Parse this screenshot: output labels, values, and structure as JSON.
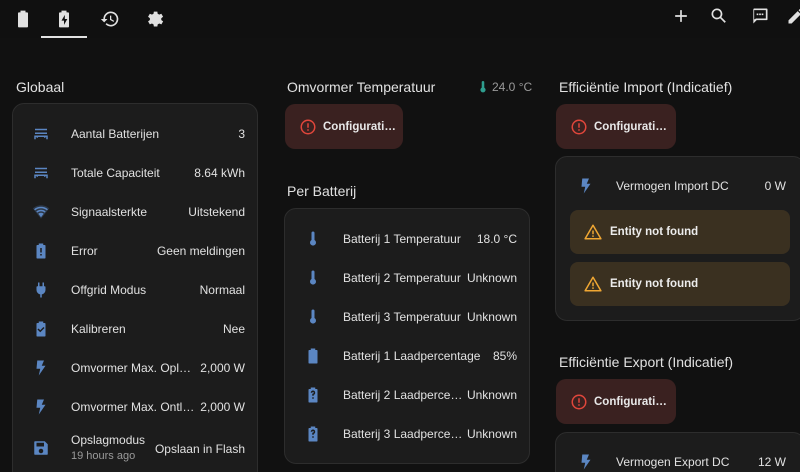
{
  "colors": {
    "accent_icon": "#5b86c2",
    "error": "#e0463b",
    "warning": "#f0a733",
    "background": "#111111",
    "card": "#1c1c1c"
  },
  "topbar": {
    "tabs": [
      {
        "icon": "battery-icon",
        "active": false
      },
      {
        "icon": "battery-charging-icon",
        "active": true
      },
      {
        "icon": "history-icon",
        "active": false
      },
      {
        "icon": "gear-icon",
        "active": false
      }
    ],
    "actions": [
      "plus-icon",
      "search-icon",
      "assist-icon",
      "edit-icon"
    ]
  },
  "globaal": {
    "title": "Globaal",
    "rows": [
      {
        "icon": "battery-bank-icon",
        "label": "Aantal Batterijen",
        "value": "3"
      },
      {
        "icon": "battery-bank-icon",
        "label": "Totale Capaciteit",
        "value": "8.64 kWh"
      },
      {
        "icon": "wifi-icon",
        "label": "Signaalsterkte",
        "value": "Uitstekend"
      },
      {
        "icon": "battery-alert-icon",
        "label": "Error",
        "value": "Geen meldingen"
      },
      {
        "icon": "power-plug-icon",
        "label": "Offgrid Modus",
        "value": "Normaal"
      },
      {
        "icon": "battery-check-icon",
        "label": "Kalibreren",
        "value": "Nee"
      },
      {
        "icon": "lightning-icon",
        "label": "Omvormer Max. Oplaa…",
        "value": "2,000 W"
      },
      {
        "icon": "lightning-icon",
        "label": "Omvormer Max. Ontlaa…",
        "value": "2,000 W"
      },
      {
        "icon": "save-icon",
        "label": "Opslagmodus",
        "sub": "19 hours ago",
        "value": "Opslaan in Flash"
      }
    ]
  },
  "omvormer": {
    "title": "Omvormer Temperatuur",
    "temp": "24.0 °C",
    "error": "Configurati…"
  },
  "per_batterij": {
    "title": "Per Batterij",
    "rows": [
      {
        "icon": "thermometer-icon",
        "label": "Batterij 1 Temperatuur",
        "value": "18.0 °C"
      },
      {
        "icon": "thermometer-icon",
        "label": "Batterij 2 Temperatuur",
        "value": "Unknown"
      },
      {
        "icon": "thermometer-icon",
        "label": "Batterij 3 Temperatuur",
        "value": "Unknown"
      },
      {
        "icon": "battery-icon",
        "label": "Batterij 1 Laadpercentage",
        "value": "85%"
      },
      {
        "icon": "battery-unknown-icon",
        "label": "Batterij 2 Laadpercen…",
        "value": "Unknown"
      },
      {
        "icon": "battery-unknown-icon",
        "label": "Batterij 3 Laadpercen…",
        "value": "Unknown"
      }
    ]
  },
  "eff_import": {
    "title": "Efficiëntie Import (Indicatief)",
    "error": "Configurati…",
    "row": {
      "icon": "lightning-icon",
      "label": "Vermogen Import DC",
      "value": "0 W"
    },
    "warnings": [
      "Entity not found",
      "Entity not found"
    ]
  },
  "eff_export": {
    "title": "Efficiëntie Export (Indicatief)",
    "error": "Configurati…",
    "row": {
      "icon": "lightning-icon",
      "label": "Vermogen Export DC",
      "value": "12 W"
    }
  }
}
